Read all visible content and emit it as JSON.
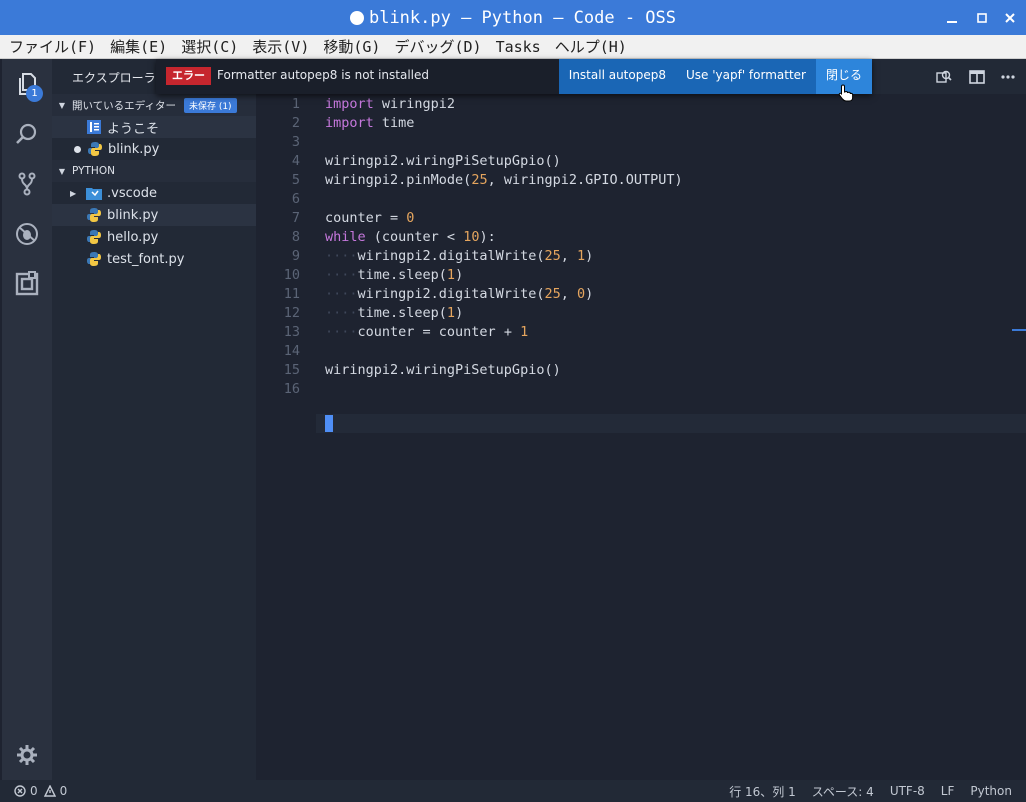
{
  "window": {
    "title": "blink.py — Python — Code - OSS",
    "minimize_glyph": "—",
    "maximize_glyph": "□",
    "close_glyph": "✕"
  },
  "menu": [
    "ファイル(F)",
    "編集(E)",
    "選択(C)",
    "表示(V)",
    "移動(G)",
    "デバッグ(D)",
    "Tasks",
    "ヘルプ(H)"
  ],
  "activity": {
    "explorer_badge": "1"
  },
  "sidebar": {
    "title": "エクスプローラー",
    "open_editors": {
      "header": "開いているエディター",
      "unsaved_badge": "未保存 (1)",
      "items": [
        {
          "label": "ようこそ",
          "icon": "welcome-icon",
          "modified": false
        },
        {
          "label": "blink.py",
          "icon": "python-icon",
          "modified": true
        }
      ]
    },
    "folder": {
      "header": "PYTHON",
      "items": [
        {
          "label": ".vscode",
          "icon": "folder-vscode-icon"
        },
        {
          "label": "blink.py",
          "icon": "python-icon"
        },
        {
          "label": "hello.py",
          "icon": "python-icon"
        },
        {
          "label": "test_font.py",
          "icon": "python-icon"
        }
      ]
    }
  },
  "notification": {
    "severity": "エラー",
    "message": "Formatter autopep8 is not installed",
    "actions": [
      "Install autopep8",
      "Use 'yapf' formatter",
      "閉じる"
    ]
  },
  "editor": {
    "cursor_line": 16,
    "lines": [
      {
        "n": "1",
        "text": "import wiringpi2"
      },
      {
        "n": "2",
        "text": "import time"
      },
      {
        "n": "3",
        "text": ""
      },
      {
        "n": "4",
        "text": "wiringpi2.wiringPiSetupGpio()"
      },
      {
        "n": "5",
        "text": "wiringpi2.pinMode(25, wiringpi2.GPIO.OUTPUT)"
      },
      {
        "n": "6",
        "text": ""
      },
      {
        "n": "7",
        "text": "counter = 0"
      },
      {
        "n": "8",
        "text": "while (counter < 10):"
      },
      {
        "n": "9",
        "text": "····wiringpi2.digitalWrite(25, 1)"
      },
      {
        "n": "10",
        "text": "····time.sleep(1)"
      },
      {
        "n": "11",
        "text": "····wiringpi2.digitalWrite(25, 0)"
      },
      {
        "n": "12",
        "text": "····time.sleep(1)"
      },
      {
        "n": "13",
        "text": "····counter = counter + 1"
      },
      {
        "n": "14",
        "text": ""
      },
      {
        "n": "15",
        "text": "wiringpi2.wiringPiSetupGpio()"
      },
      {
        "n": "16",
        "text": ""
      }
    ]
  },
  "status": {
    "errors": "0",
    "warnings": "0",
    "position": "行 16、列 1",
    "indent": "スペース: 4",
    "encoding": "UTF-8",
    "eol": "LF",
    "language": "Python"
  },
  "colors": {
    "titlebar": "#3b7ad8",
    "keyword": "#c678dd",
    "number": "#e5a55e",
    "error": "#c6262e",
    "action": "#1a66b5"
  }
}
